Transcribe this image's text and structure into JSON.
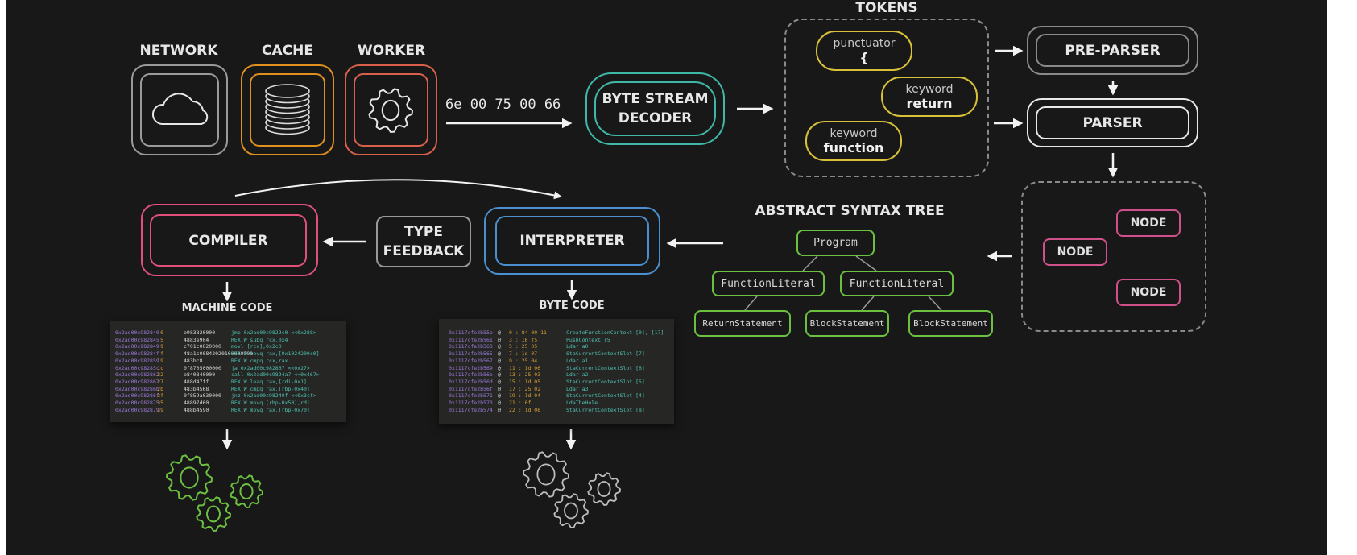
{
  "sources": [
    {
      "label": "NETWORK",
      "icon": "cloud-icon",
      "color": "#9a9a9a"
    },
    {
      "label": "CACHE",
      "icon": "database-icon",
      "color": "#e0901e"
    },
    {
      "label": "WORKER",
      "icon": "gear-icon",
      "color": "#d9604a"
    }
  ],
  "byte_stream": "6e 00 75 00 66",
  "decoder": {
    "line1": "BYTE STREAM",
    "line2": "DECODER",
    "color": "#3fb8a8"
  },
  "tokens": {
    "title": "TOKENS",
    "color": "#d8c038",
    "items": [
      {
        "kind": "punctuator",
        "value": "{"
      },
      {
        "kind": "keyword",
        "value": "return"
      },
      {
        "kind": "keyword",
        "value": "function"
      }
    ]
  },
  "pre_parser": {
    "label": "PRE-PARSER",
    "color": "#8a8a8a"
  },
  "parser": {
    "label": "PARSER",
    "color": "#e8e8e8"
  },
  "nodes": {
    "label": "NODE",
    "color": "#d0508a",
    "items": [
      "NODE",
      "NODE",
      "NODE"
    ]
  },
  "ast": {
    "title": "ABSTRACT SYNTAX TREE",
    "color": "#6cc040",
    "program": "Program",
    "function_literals": [
      "FunctionLiteral",
      "FunctionLiteral"
    ],
    "statements": [
      "ReturnStatement",
      "BlockStatement",
      "BlockStatement"
    ]
  },
  "interpreter": {
    "label": "INTERPRETER",
    "color": "#4a90d0"
  },
  "type_feedback": {
    "line1": "TYPE",
    "line2": "FEEDBACK"
  },
  "compiler": {
    "label": "COMPILER",
    "color": "#e0507a"
  },
  "machine_code": {
    "title": "MACHINE CODE",
    "gear_color": "#6cc040",
    "rows": [
      [
        "0x2ad00c982840",
        "0",
        "e983820000",
        "jmp 0x2ad00c9822c0  <<0x288>"
      ],
      [
        "0x2ad00c982845",
        "5",
        "4883e904",
        "REX.W subq rcx,0x4"
      ],
      [
        "0x2ad00c982849",
        "9",
        "c701c0020000",
        "movl [rcx],0x2c0"
      ],
      [
        "0x2ad00c98284f",
        "f",
        "48a1c00842020100000000",
        "REX.W movq rax,[0x1024200c0]"
      ],
      [
        "0x2ad00c982859",
        "19",
        "483bc8",
        "REX.W cmpq rcx,rax"
      ],
      [
        "0x2ad00c98285c",
        "1c",
        "0f8705000000",
        "ja 0x2ad00c982867  <<0x27>"
      ],
      [
        "0x2ad00c982862",
        "22",
        "e840840000",
        "call 0x2ad00c9824a7  <<0x467>"
      ],
      [
        "0x2ad00c982867",
        "27",
        "488d47ff",
        "REX.W leaq rax,[rdi-0x1]"
      ],
      [
        "0x2ad00c98286b",
        "2b",
        "483b4568",
        "REX.W cmpq rax,[rbp-0x40]"
      ],
      [
        "0x2ad00c98286f",
        "2f",
        "0f859a030000",
        "jnz 0x2ad00c98240f  <<0x3cf>"
      ],
      [
        "0x2ad00c982875",
        "35",
        "48897d60",
        "REX.W movq [rbp-0x50],rdi"
      ],
      [
        "0x2ad00c982879",
        "39",
        "488b4590",
        "REX.W movq rax,[rbp-0x70]"
      ]
    ]
  },
  "byte_code": {
    "title": "BYTE CODE",
    "gear_color": "#bdbdbd",
    "rows": [
      [
        "0x1117cfe2b55e",
        "@",
        "0 : 84 00 11",
        "CreateFunctionContext [0], [17]"
      ],
      [
        "0x1117cfe2b561",
        "@",
        "3 : 16 f5",
        "PushContext r5"
      ],
      [
        "0x1117cfe2b563",
        "@",
        "5 : 25 05",
        "Ldar a0"
      ],
      [
        "0x1117cfe2b565",
        "@",
        "7 : 1d 07",
        "StaCurrentContextSlot [7]"
      ],
      [
        "0x1117cfe2b567",
        "@",
        "9 : 25 04",
        "Ldar a1"
      ],
      [
        "0x1117cfe2b569",
        "@",
        "11 : 1d 06",
        "StaCurrentContextSlot [6]"
      ],
      [
        "0x1117cfe2b56b",
        "@",
        "13 : 25 03",
        "Ldar a2"
      ],
      [
        "0x1117cfe2b56d",
        "@",
        "15 : 1d 05",
        "StaCurrentContextSlot [5]"
      ],
      [
        "0x1117cfe2b56f",
        "@",
        "17 : 25 02",
        "Ldar a3"
      ],
      [
        "0x1117cfe2b571",
        "@",
        "19 : 1d 04",
        "StaCurrentContextSlot [4]"
      ],
      [
        "0x1117cfe2b573",
        "@",
        "21 : 0f",
        "LdaTheHole"
      ],
      [
        "0x1117cfe2b574",
        "@",
        "22 : 1d 08",
        "StaCurrentContextSlot [8]"
      ]
    ]
  }
}
